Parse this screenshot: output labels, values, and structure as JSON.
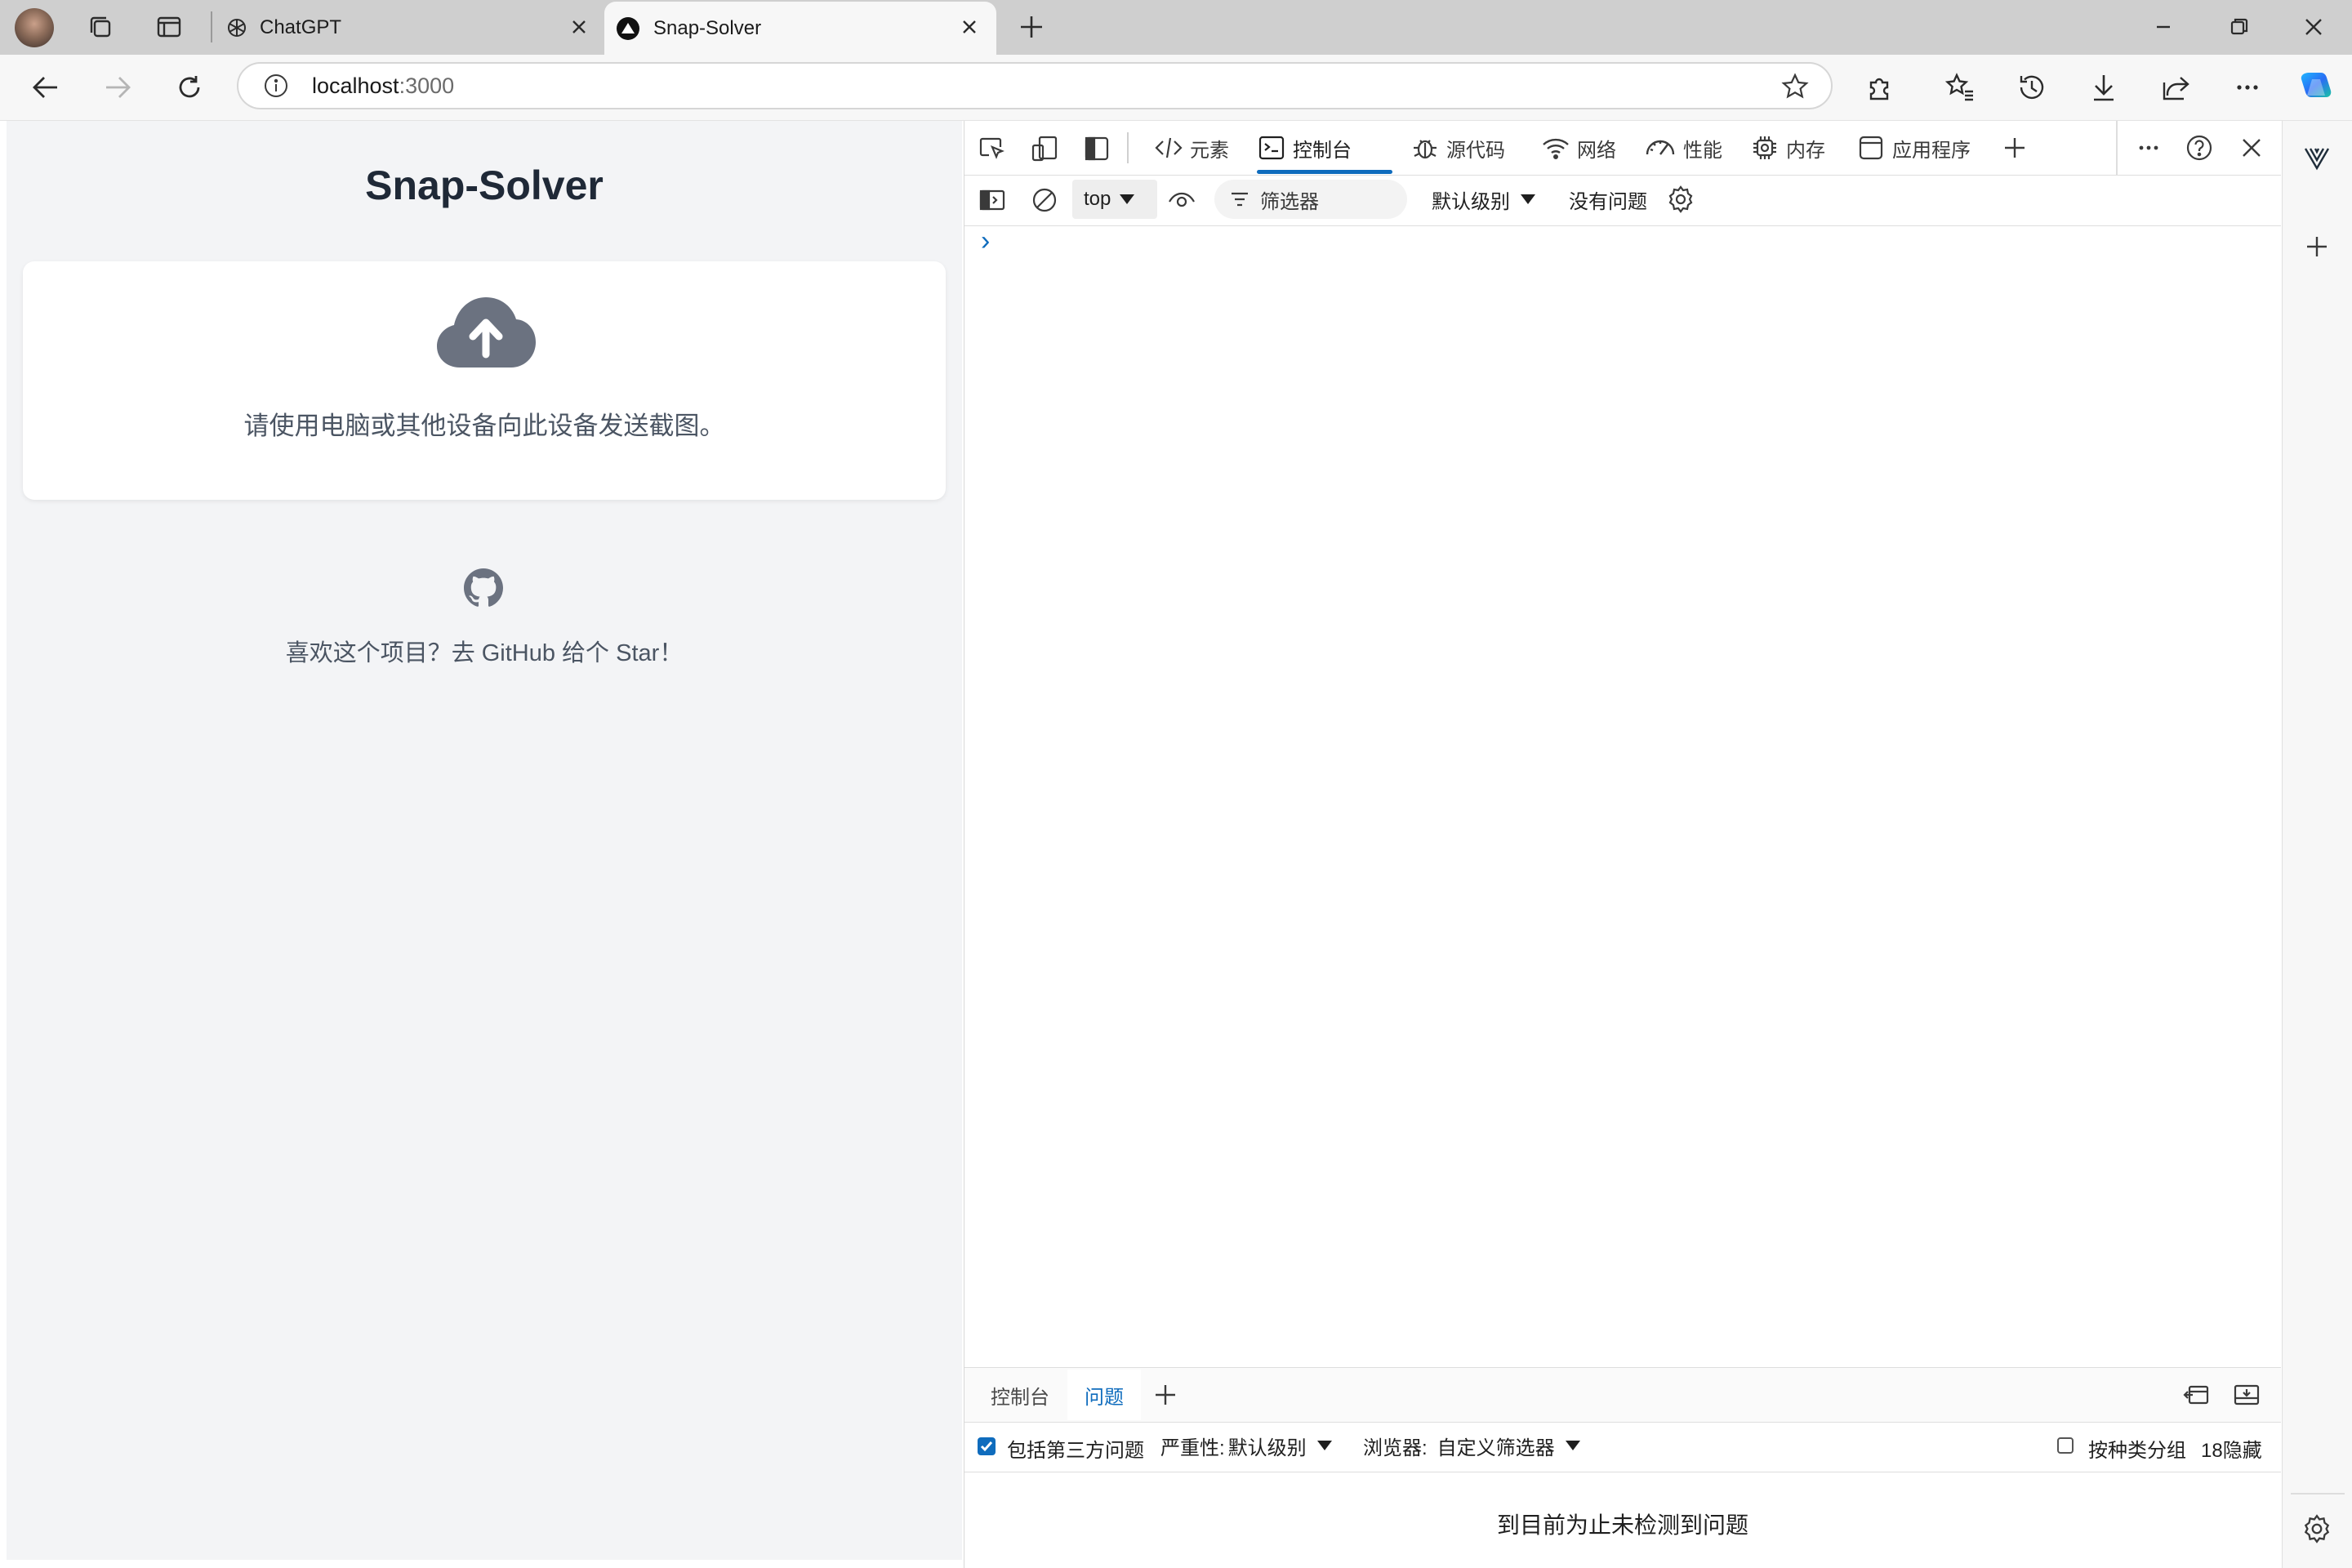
{
  "browser": {
    "tabs": [
      {
        "label": "ChatGPT",
        "icon": "openai-icon",
        "active": false
      },
      {
        "label": "Snap-Solver",
        "icon": "vercel-triangle-icon",
        "active": true
      }
    ],
    "address": {
      "host": "localhost",
      "port": ":3000"
    }
  },
  "page": {
    "title": "Snap-Solver",
    "upload_hint": "请使用电脑或其他设备向此设备发送截图。",
    "github_text": "喜欢这个项目？去 GitHub 给个 Star！"
  },
  "devtools": {
    "tabs": [
      {
        "label": "元素",
        "icon": "code-brackets-icon"
      },
      {
        "label": "控制台",
        "icon": "console-icon",
        "active": true
      },
      {
        "label": "源代码",
        "icon": "bug-icon"
      },
      {
        "label": "网络",
        "icon": "wifi-icon"
      },
      {
        "label": "性能",
        "icon": "gauge-icon"
      },
      {
        "label": "内存",
        "icon": "chip-icon"
      },
      {
        "label": "应用程序",
        "icon": "app-window-icon"
      }
    ],
    "context": "top",
    "filter_placeholder": "筛选器",
    "level": "默认级别",
    "no_issues": "没有问题",
    "prompt_symbol": "›",
    "drawer": {
      "tabs": [
        {
          "label": "控制台",
          "active": false
        },
        {
          "label": "问题",
          "active": true
        }
      ],
      "include_third_party": "包括第三方问题",
      "severity_label": "严重性:",
      "severity_value": "默认级别",
      "browser_label": "浏览器:",
      "browser_value": "自定义筛选器",
      "group_by_kind": "按种类分组",
      "hidden_count": "18隐藏",
      "empty_message": "到目前为止未检测到问题"
    }
  },
  "colors": {
    "accent": "#0f6cbd",
    "page_bg": "#f3f4f6",
    "title": "#1f2937",
    "muted": "#4b5563",
    "icon": "#6b7280"
  }
}
